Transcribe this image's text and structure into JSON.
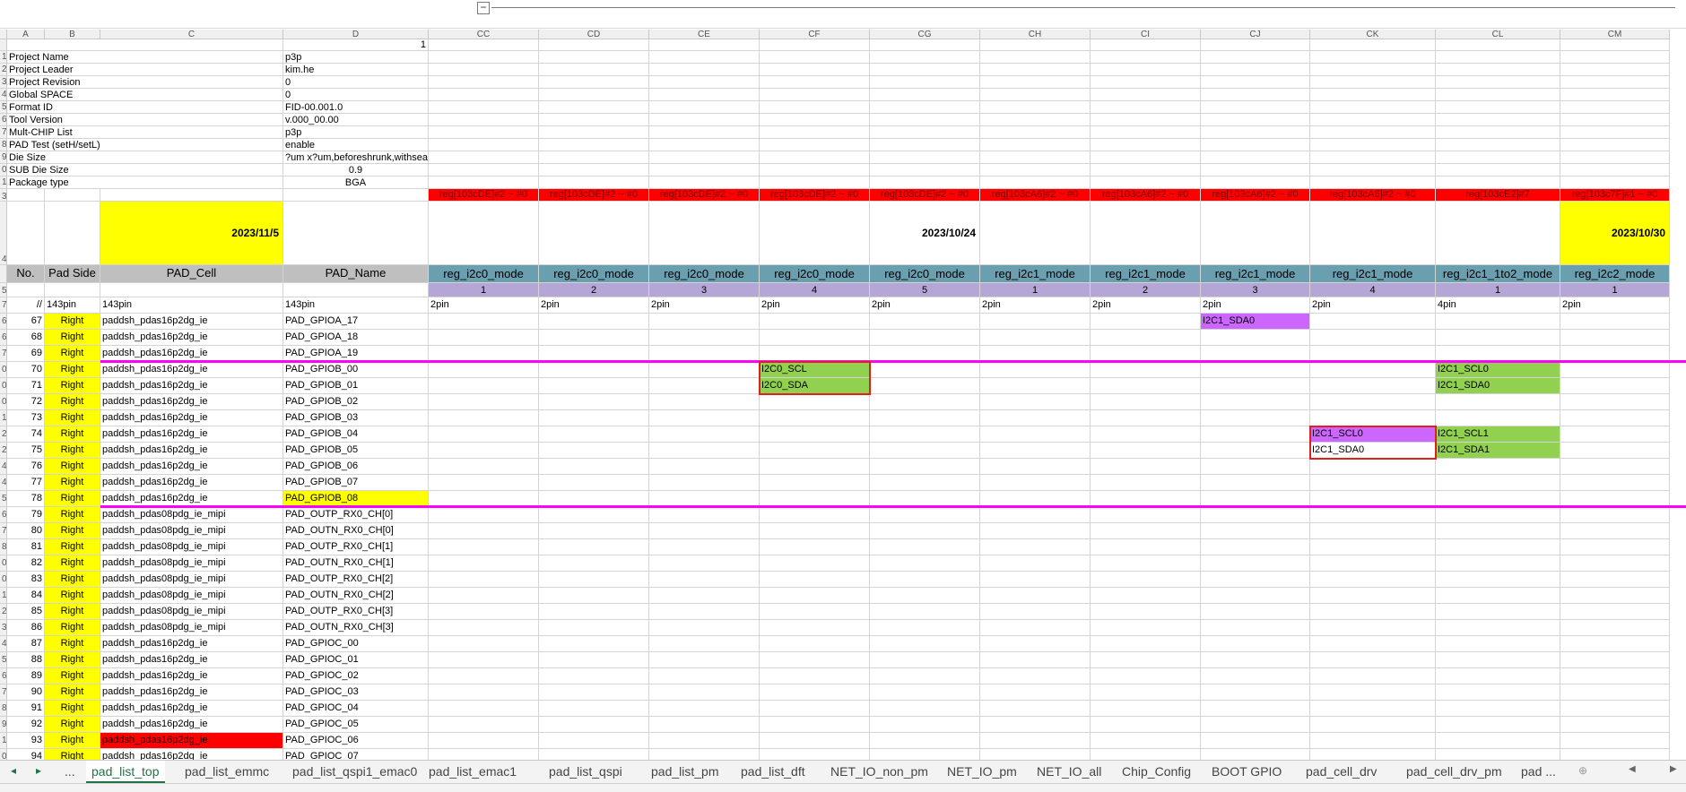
{
  "columns": [
    "A",
    "B",
    "C",
    "D",
    "CC",
    "CD",
    "CE",
    "CF",
    "CG",
    "CH",
    "CI",
    "CJ",
    "CK",
    "CL",
    "CM"
  ],
  "corner_value": "1",
  "project_info": [
    {
      "row": "1",
      "label": "Project Name",
      "value": "p3p"
    },
    {
      "row": "2",
      "label": "Project Leader",
      "value": "kim.he"
    },
    {
      "row": "3",
      "label": "Project Revision",
      "value": "0"
    },
    {
      "row": "4",
      "label": "Global SPACE",
      "value": "0"
    },
    {
      "row": "5",
      "label": "Format ID",
      "value": "FID-00.001.0"
    },
    {
      "row": "6",
      "label": "Tool Version",
      "value": "v.000_00.00"
    },
    {
      "row": "7",
      "label": "Mult-CHIP List",
      "value": "p3p"
    },
    {
      "row": "8",
      "label": "PAD Test (setH/setL)",
      "value": "enable"
    },
    {
      "row": "9",
      "label": "Die Size",
      "value": "?um x?um,beforeshrunk,withsealring"
    },
    {
      "row": "0",
      "label": "SUB Die Size",
      "value": "0.9"
    },
    {
      "row": "1",
      "label": "Package type",
      "value": "BGA"
    }
  ],
  "reg_row": [
    "reg[103cDE]#2 ~ #0",
    "reg[103cDE]#2 ~ #0",
    "reg[103cDE]#2 ~ #0",
    "reg[103cDE]#2 ~ #0",
    "reg[103cDE]#2 ~ #0",
    "reg[103cA6]#2 ~ #0",
    "reg[103cA6]#2 ~ #0",
    "reg[103cA6]#2 ~ #0",
    "reg[103cA6]#2 ~ #0",
    "reg[103cE2]#7",
    "reg[103c7F]#1 ~ #0"
  ],
  "dates": {
    "c": "2023/11/5",
    "cg": "2023/10/24",
    "cm": "2023/10/30"
  },
  "header": {
    "no": "No.",
    "pad_side": "Pad Side",
    "pad_cell": "PAD_Cell",
    "pad_name": "PAD_Name"
  },
  "modes": [
    "reg_i2c0_mode",
    "reg_i2c0_mode",
    "reg_i2c0_mode",
    "reg_i2c0_mode",
    "reg_i2c0_mode",
    "reg_i2c1_mode",
    "reg_i2c1_mode",
    "reg_i2c1_mode",
    "reg_i2c1_mode",
    "reg_i2c1_1to2_mode",
    "reg_i2c2_mode"
  ],
  "mode_index": [
    "1",
    "2",
    "3",
    "4",
    "5",
    "1",
    "2",
    "3",
    "4",
    "1",
    "1"
  ],
  "pin_row": {
    "a": "//",
    "b": "143pin",
    "c": "143pin",
    "d": "143pin",
    "pins": [
      "2pin",
      "2pin",
      "2pin",
      "2pin",
      "2pin",
      "2pin",
      "2pin",
      "2pin",
      "2pin",
      "4pin",
      "2pin"
    ]
  },
  "rows": [
    {
      "rh": "6",
      "no": "67",
      "side": "Right",
      "cell": "paddsh_pdas16p2dg_ie",
      "name": "PAD_GPIOA_17"
    },
    {
      "rh": "6",
      "no": "68",
      "side": "Right",
      "cell": "paddsh_pdas16p2dg_ie",
      "name": "PAD_GPIOA_18"
    },
    {
      "rh": "7",
      "no": "69",
      "side": "Right",
      "cell": "paddsh_pdas16p2dg_ie",
      "name": "PAD_GPIOA_19"
    },
    {
      "rh": "0",
      "no": "70",
      "side": "Right",
      "cell": "paddsh_pdas16p2dg_ie",
      "name": "PAD_GPIOB_00"
    },
    {
      "rh": "0",
      "no": "71",
      "side": "Right",
      "cell": "paddsh_pdas16p2dg_ie",
      "name": "PAD_GPIOB_01"
    },
    {
      "rh": "0",
      "no": "72",
      "side": "Right",
      "cell": "paddsh_pdas16p2dg_ie",
      "name": "PAD_GPIOB_02"
    },
    {
      "rh": "1",
      "no": "73",
      "side": "Right",
      "cell": "paddsh_pdas16p2dg_ie",
      "name": "PAD_GPIOB_03"
    },
    {
      "rh": "2",
      "no": "74",
      "side": "Right",
      "cell": "paddsh_pdas16p2dg_ie",
      "name": "PAD_GPIOB_04"
    },
    {
      "rh": "2",
      "no": "75",
      "side": "Right",
      "cell": "paddsh_pdas16p2dg_ie",
      "name": "PAD_GPIOB_05"
    },
    {
      "rh": "4",
      "no": "76",
      "side": "Right",
      "cell": "paddsh_pdas16p2dg_ie",
      "name": "PAD_GPIOB_06"
    },
    {
      "rh": "4",
      "no": "77",
      "side": "Right",
      "cell": "paddsh_pdas16p2dg_ie",
      "name": "PAD_GPIOB_07"
    },
    {
      "rh": "5",
      "no": "78",
      "side": "Right",
      "cell": "paddsh_pdas16p2dg_ie",
      "name": "PAD_GPIOB_08"
    },
    {
      "rh": "6",
      "no": "79",
      "side": "Right",
      "cell": "paddsh_pdas08pdg_ie_mipi",
      "name": "PAD_OUTP_RX0_CH[0]"
    },
    {
      "rh": "7",
      "no": "80",
      "side": "Right",
      "cell": "paddsh_pdas08pdg_ie_mipi",
      "name": "PAD_OUTN_RX0_CH[0]"
    },
    {
      "rh": "8",
      "no": "81",
      "side": "Right",
      "cell": "paddsh_pdas08pdg_ie_mipi",
      "name": "PAD_OUTP_RX0_CH[1]"
    },
    {
      "rh": "0",
      "no": "82",
      "side": "Right",
      "cell": "paddsh_pdas08pdg_ie_mipi",
      "name": "PAD_OUTN_RX0_CH[1]"
    },
    {
      "rh": "0",
      "no": "83",
      "side": "Right",
      "cell": "paddsh_pdas08pdg_ie_mipi",
      "name": "PAD_OUTP_RX0_CH[2]"
    },
    {
      "rh": "1",
      "no": "84",
      "side": "Right",
      "cell": "paddsh_pdas08pdg_ie_mipi",
      "name": "PAD_OUTN_RX0_CH[2]"
    },
    {
      "rh": "2",
      "no": "85",
      "side": "Right",
      "cell": "paddsh_pdas08pdg_ie_mipi",
      "name": "PAD_OUTP_RX0_CH[3]"
    },
    {
      "rh": "3",
      "no": "86",
      "side": "Right",
      "cell": "paddsh_pdas08pdg_ie_mipi",
      "name": "PAD_OUTN_RX0_CH[3]"
    },
    {
      "rh": "4",
      "no": "87",
      "side": "Right",
      "cell": "paddsh_pdas16p2dg_ie",
      "name": "PAD_GPIOC_00"
    },
    {
      "rh": "5",
      "no": "88",
      "side": "Right",
      "cell": "paddsh_pdas16p2dg_ie",
      "name": "PAD_GPIOC_01"
    },
    {
      "rh": "6",
      "no": "89",
      "side": "Right",
      "cell": "paddsh_pdas16p2dg_ie",
      "name": "PAD_GPIOC_02"
    },
    {
      "rh": "7",
      "no": "90",
      "side": "Right",
      "cell": "paddsh_pdas16p2dg_ie",
      "name": "PAD_GPIOC_03"
    },
    {
      "rh": "8",
      "no": "91",
      "side": "Right",
      "cell": "paddsh_pdas16p2dg_ie",
      "name": "PAD_GPIOC_04"
    },
    {
      "rh": "9",
      "no": "92",
      "side": "Right",
      "cell": "paddsh_pdas16p2dg_ie",
      "name": "PAD_GPIOC_05"
    },
    {
      "rh": "1",
      "no": "93",
      "side": "Right",
      "cell": "paddsh_pdas16p2dg_ie",
      "name": "PAD_GPIOC_06"
    },
    {
      "rh": "0",
      "no": "94",
      "side": "Right",
      "cell": "paddsh_pdas16p2dg_ie",
      "name": "PAD_GPIOC_07"
    }
  ],
  "cell_values": [
    {
      "row": 0,
      "col": 7,
      "text": "I2C1_SDA0",
      "color": "#cc66ff"
    },
    {
      "row": 3,
      "col": 3,
      "text": "I2C0_SCL",
      "color": "#92d050"
    },
    {
      "row": 3,
      "col": 9,
      "text": "I2C1_SCL0",
      "color": "#92d050"
    },
    {
      "row": 4,
      "col": 3,
      "text": "I2C0_SDA",
      "color": "#92d050"
    },
    {
      "row": 4,
      "col": 9,
      "text": "I2C1_SDA0",
      "color": "#92d050"
    },
    {
      "row": 7,
      "col": 8,
      "text": "I2C1_SCL0",
      "color": "#cc66ff"
    },
    {
      "row": 7,
      "col": 9,
      "text": "I2C1_SCL1",
      "color": "#92d050"
    },
    {
      "row": 8,
      "col": 8,
      "text": "I2C1_SDA0",
      "color": ""
    },
    {
      "row": 8,
      "col": 9,
      "text": "I2C1_SDA1",
      "color": "#92d050"
    }
  ],
  "highlight_colors": {
    "yellow": "#ffff00",
    "red": "#ff0000",
    "green": "#92d050",
    "purple": "#cc66ff",
    "magenta": "#ff00ff",
    "header_gray": "#bfbfbf",
    "mode_teal": "#6a9fb0",
    "index_purple": "#b4a7d6",
    "excel_green": "#217346"
  },
  "tabs": [
    "...",
    "pad_list_top",
    "pad_list_emmc",
    "pad_list_qspi1_emac0",
    "pad_list_emac1",
    "pad_list_qspi",
    "pad_list_pm",
    "pad_list_dft",
    "NET_IO_non_pm",
    "NET_IO_pm",
    "NET_IO_all",
    "Chip_Config",
    "BOOT GPIO",
    "pad_cell_drv",
    "pad_cell_drv_pm",
    "pad ..."
  ],
  "active_tab": "pad_list_top",
  "icons": {
    "prev": "◂",
    "next": "▸",
    "add": "⊕",
    "scroll_left": "◀",
    "scroll_right": "▶",
    "collapse": "−"
  }
}
